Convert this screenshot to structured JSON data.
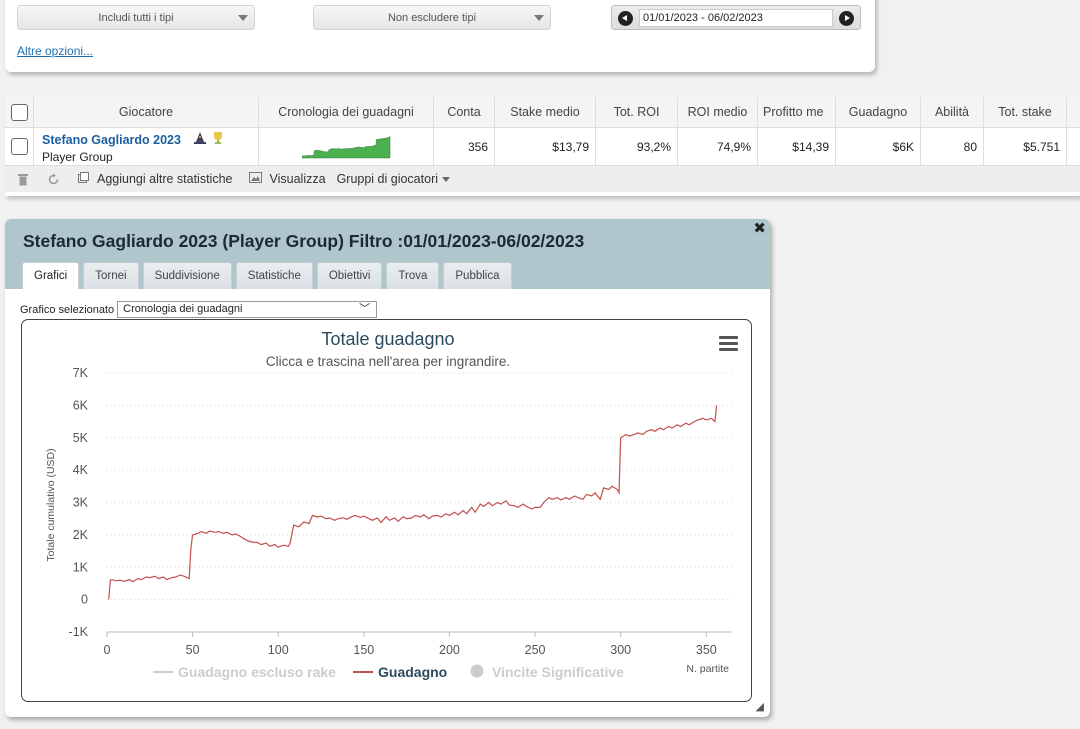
{
  "filters": {
    "type_include": "Includi tutti i tipi",
    "type_exclude": "Non escludere tipi",
    "date_range": "01/01/2023 - 06/02/2023",
    "more_options": "Altre opzioni..."
  },
  "table": {
    "headers": [
      "Giocatore",
      "Cronologia dei guadagni",
      "Conta",
      "Stake medio",
      "Tot. ROI",
      "ROI medio",
      "Profitto me",
      "Guadagno",
      "Abilità",
      "Tot. stake"
    ],
    "row": {
      "player_name": "Stefano Gagliardo 2023",
      "player_group": "Player Group",
      "conta": "356",
      "stake_medio": "$13,79",
      "tot_roi": "93,2%",
      "roi_medio": "74,9%",
      "profitto_medio": "$14,39",
      "guadagno": "$6K",
      "abilita": "80",
      "tot_stake": "$5.751"
    },
    "toolbar": {
      "add_stats": "Aggiungi altre statistiche",
      "view": "Visualizza",
      "groups": "Gruppi di giocatori"
    }
  },
  "dialog": {
    "title": "Stefano Gagliardo 2023 (Player Group) Filtro :01/01/2023-06/02/2023",
    "tabs": [
      "Grafici",
      "Tornei",
      "Suddivisione",
      "Statistiche",
      "Obiettivi",
      "Trova",
      "Pubblica"
    ],
    "active_tab": "Grafici",
    "chart_select_label": "Grafico selezionato",
    "chart_select_value": "Cronologia dei guadagni"
  },
  "colors": {
    "line": "#c0504d",
    "sparkline": "#4caf50",
    "title": "#2c4a5e",
    "header_bg": "#afc6cd"
  },
  "chart_data": {
    "type": "line",
    "title": "Totale guadagno",
    "subtitle": "Clicca e trascina nell'area per ingrandire.",
    "ylabel": "Totale cumulativo (USD)",
    "xlabel": "N. partite",
    "ylim": [
      -1000,
      7000
    ],
    "xlim": [
      0,
      365
    ],
    "yticks": [
      -1000,
      0,
      1000,
      2000,
      3000,
      4000,
      5000,
      6000,
      7000
    ],
    "ytick_labels": [
      "-1K",
      "0",
      "1K",
      "2K",
      "3K",
      "4K",
      "5K",
      "6K",
      "7K"
    ],
    "xticks": [
      0,
      50,
      100,
      150,
      200,
      250,
      300,
      350
    ],
    "grid": true,
    "legend": [
      {
        "name": "Guadagno escluso rake",
        "active": false
      },
      {
        "name": "Guadagno",
        "active": true
      },
      {
        "name": "Vincite Significative",
        "active": false
      }
    ],
    "series": [
      {
        "name": "Guadagno",
        "x": [
          1,
          2,
          3,
          5,
          8,
          10,
          13,
          15,
          18,
          20,
          23,
          25,
          28,
          30,
          33,
          35,
          38,
          40,
          43,
          45,
          48,
          49,
          50,
          53,
          55,
          58,
          60,
          63,
          65,
          68,
          70,
          73,
          75,
          78,
          80,
          83,
          85,
          88,
          90,
          93,
          95,
          98,
          100,
          103,
          106,
          107,
          109,
          112,
          115,
          118,
          120,
          123,
          125,
          128,
          130,
          133,
          135,
          138,
          140,
          143,
          145,
          148,
          150,
          153,
          155,
          158,
          160,
          163,
          165,
          168,
          170,
          173,
          175,
          178,
          180,
          183,
          185,
          188,
          190,
          193,
          195,
          198,
          200,
          203,
          205,
          208,
          210,
          213,
          215,
          218,
          220,
          223,
          225,
          228,
          230,
          233,
          235,
          238,
          240,
          243,
          245,
          248,
          250,
          253,
          255,
          258,
          260,
          263,
          265,
          268,
          270,
          273,
          275,
          278,
          280,
          283,
          285,
          288,
          290,
          293,
          295,
          298,
          299,
          300,
          303,
          305,
          308,
          310,
          313,
          315,
          318,
          320,
          323,
          325,
          328,
          330,
          333,
          335,
          338,
          340,
          343,
          345,
          348,
          350,
          353,
          355,
          356
        ],
        "values": [
          0,
          600,
          620,
          580,
          600,
          560,
          620,
          550,
          650,
          620,
          700,
          680,
          720,
          650,
          700,
          620,
          680,
          700,
          760,
          720,
          650,
          1600,
          2000,
          2050,
          2100,
          2050,
          2120,
          2080,
          2100,
          2050,
          2080,
          2000,
          2030,
          1950,
          1880,
          1800,
          1780,
          1760,
          1700,
          1750,
          1650,
          1700,
          1620,
          1680,
          1650,
          1750,
          2300,
          2250,
          2400,
          2350,
          2600,
          2550,
          2580,
          2500,
          2520,
          2450,
          2500,
          2530,
          2480,
          2560,
          2600,
          2540,
          2580,
          2500,
          2450,
          2520,
          2380,
          2560,
          2450,
          2520,
          2420,
          2560,
          2500,
          2520,
          2600,
          2550,
          2620,
          2500,
          2580,
          2600,
          2550,
          2650,
          2600,
          2700,
          2620,
          2750,
          2650,
          2850,
          2700,
          2950,
          2880,
          3000,
          2900,
          3000,
          2950,
          3050,
          2920,
          2900,
          2850,
          2950,
          2880,
          2800,
          2850,
          2850,
          3000,
          3150,
          3100,
          3150,
          3080,
          3150,
          3100,
          3200,
          3150,
          3100,
          3250,
          3200,
          3300,
          3100,
          3450,
          3400,
          3500,
          3400,
          3300,
          5000,
          5100,
          5050,
          5100,
          5150,
          5100,
          5200,
          5250,
          5200,
          5300,
          5250,
          5350,
          5300,
          5400,
          5350,
          5450,
          5400,
          5500,
          5550,
          5600,
          5550,
          5600,
          5500,
          6000
        ]
      }
    ]
  }
}
